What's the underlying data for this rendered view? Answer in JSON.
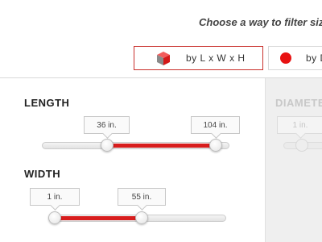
{
  "header": {
    "title": "Choose a way to filter size"
  },
  "mode_tabs": [
    {
      "label": "by L x W x H",
      "icon": "cube-icon",
      "selected": true
    },
    {
      "label": "by D",
      "icon": "red-circle-icon",
      "selected": false
    }
  ],
  "filters": {
    "length": {
      "label": "LENGTH",
      "min_label": "36 in.",
      "max_label": "104 in."
    },
    "width": {
      "label": "WIDTH",
      "min_label": "1 in.",
      "max_label": "55 in."
    },
    "diameter": {
      "label": "DIAMETE",
      "min_label": "1 in.",
      "enabled": false
    }
  },
  "colors": {
    "accent": "#d81d1d",
    "selected_border": "#c9302c",
    "disabled_panel": "#efefef"
  }
}
